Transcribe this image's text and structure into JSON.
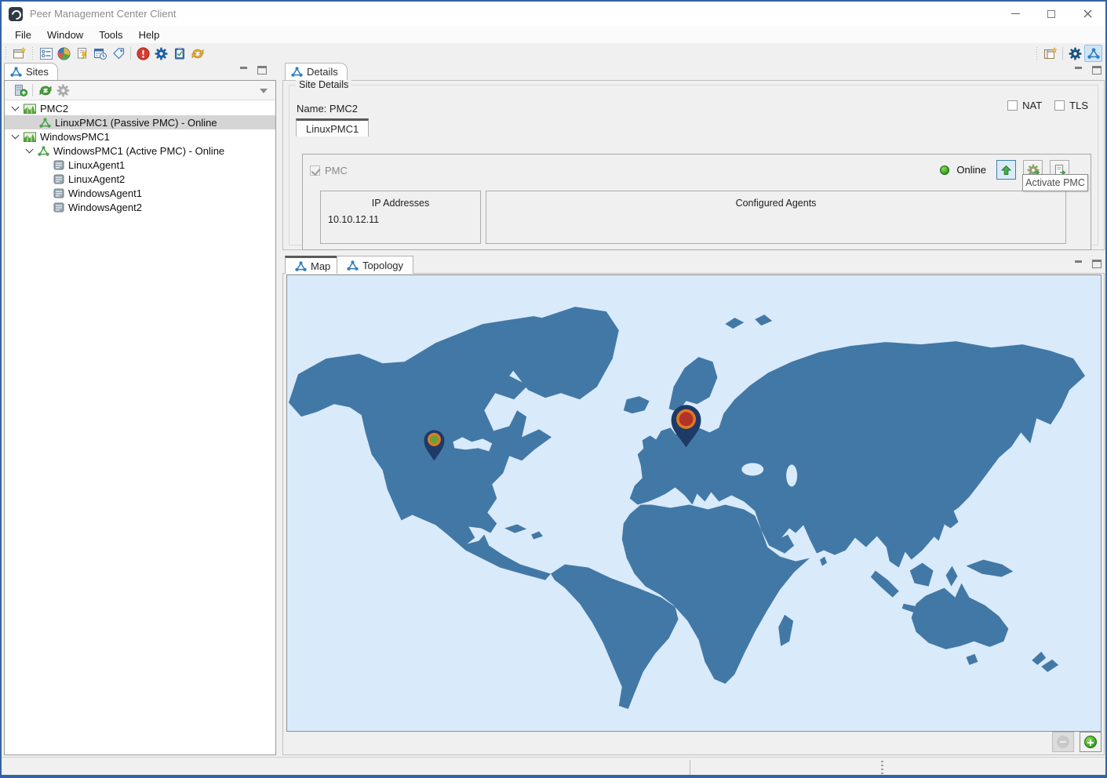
{
  "window": {
    "title": "Peer Management Center Client"
  },
  "menubar": [
    "File",
    "Window",
    "Tools",
    "Help"
  ],
  "main_toolbar": {
    "left_icons": [
      "new-window",
      "views",
      "analytics",
      "run-report",
      "schedule",
      "tags",
      "alerts",
      "preferences",
      "tasks",
      "sync"
    ],
    "right_icons": [
      "open-perspective",
      "preferences",
      "pmc-perspective"
    ]
  },
  "sites_panel": {
    "tab_label": "Sites",
    "toolbar_icons": [
      "add-site",
      "refresh",
      "settings"
    ],
    "tree": [
      {
        "label": "PMC2",
        "level": 0,
        "icon": "site",
        "expanded": true,
        "selected": false
      },
      {
        "label": "LinuxPMC1 (Passive PMC) - Online",
        "level": 1,
        "icon": "pmc",
        "selected": true
      },
      {
        "label": "WindowsPMC1",
        "level": 0,
        "icon": "site",
        "expanded": true,
        "selected": false
      },
      {
        "label": "WindowsPMC1 (Active PMC) - Online",
        "level": 1,
        "icon": "pmc",
        "expanded": true,
        "selected": false
      },
      {
        "label": "LinuxAgent1",
        "level": 2,
        "icon": "agent",
        "selected": false
      },
      {
        "label": "LinuxAgent2",
        "level": 2,
        "icon": "agent",
        "selected": false
      },
      {
        "label": "WindowsAgent1",
        "level": 2,
        "icon": "agent",
        "selected": false
      },
      {
        "label": "WindowsAgent2",
        "level": 2,
        "icon": "agent",
        "selected": false
      }
    ]
  },
  "details_panel": {
    "tab_label": "Details",
    "group_label": "Site Details",
    "name_value": "Name: PMC2",
    "nat_label": "NAT",
    "tls_label": "TLS",
    "site_tab_label": "LinuxPMC1",
    "pmc_checkbox_label": "PMC",
    "status_label": "Online",
    "tooltip": "Activate PMC",
    "ip_box": {
      "title": "IP Addresses",
      "values": [
        "10.10.12.11"
      ]
    },
    "agents_box": {
      "title": "Configured Agents",
      "values": []
    }
  },
  "map_panel": {
    "tabs": [
      {
        "label": "Map",
        "active": true
      },
      {
        "label": "Topology",
        "active": false
      }
    ],
    "pins": [
      {
        "name": "map-pin-us",
        "center_color": "#6f9d3d"
      },
      {
        "name": "map-pin-europe",
        "center_color": "#b23329"
      }
    ]
  },
  "colors": {
    "ocean": "#d9eafb",
    "land": "#4278a6",
    "pin_body": "#1e3a66",
    "pin_ring": "#e07b20",
    "pin_us_center": "#6f9d3d",
    "pin_eu_center": "#b23329",
    "online_green": "#3fae49",
    "window_border": "#3463a4",
    "selection_gray": "#d5d5d5"
  }
}
